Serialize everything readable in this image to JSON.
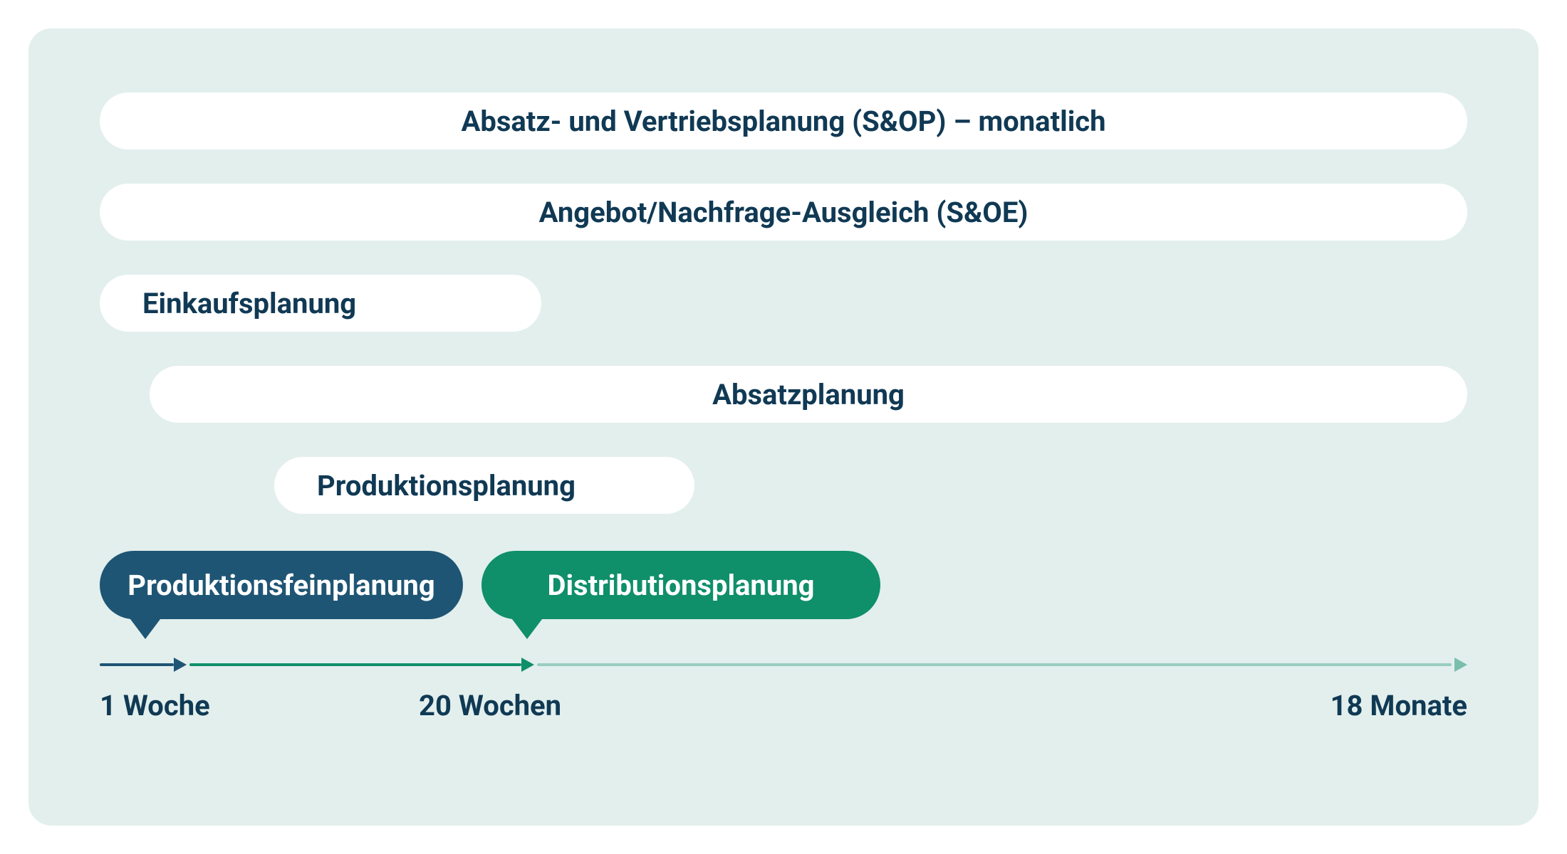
{
  "colors": {
    "navy": "#103954",
    "deepnavy": "#1f5574",
    "green": "#0f8f6a",
    "panel": "#e2efed",
    "white": "#ffffff"
  },
  "rows": {
    "sop": "Absatz- und Vertriebsplanung (S&OP) – monatlich",
    "soe": "Angebot/Nachfrage-Ausgleich (S&OE)",
    "einkauf": "Einkaufsplanung",
    "absatz": "Absatzplanung",
    "produktion": "Produktionsplanung"
  },
  "bubbles": {
    "feinplanung": "Produktionsfeinplanung",
    "distribution": "Distributionsplanung"
  },
  "timeline": {
    "label_left": "1 Woche",
    "label_mid": "20 Wochen",
    "label_right": "18 Monate"
  }
}
